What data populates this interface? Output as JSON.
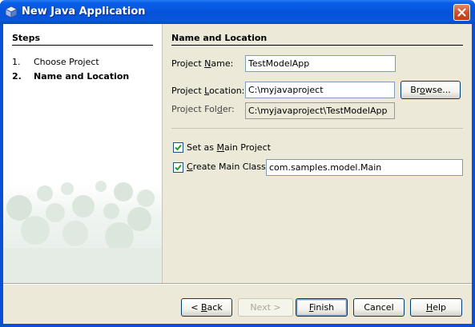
{
  "window": {
    "title": "New Java Application",
    "title_icon": "cube-icon",
    "close_icon": "close-icon"
  },
  "steps": {
    "heading": "Steps",
    "items": [
      {
        "num": "1.",
        "label": "Choose Project",
        "current": false
      },
      {
        "num": "2.",
        "label": "Name and Location",
        "current": true
      }
    ]
  },
  "content": {
    "heading": "Name and Location",
    "project_name": {
      "label_pre": "Project ",
      "label_mnemonic": "N",
      "label_post": "ame:",
      "value": "TestModelApp"
    },
    "project_location": {
      "label_pre": "Project ",
      "label_mnemonic": "L",
      "label_post": "ocation:",
      "value": "C:\\myjavaproject"
    },
    "project_folder": {
      "label_pre": "Project Fol",
      "label_mnemonic": "d",
      "label_post": "er:",
      "value": "C:\\myjavaproject\\TestModelApp"
    },
    "browse": {
      "pre": "Br",
      "mnemonic": "o",
      "post": "wse..."
    },
    "set_main": {
      "checked": true,
      "label_pre": "Set as ",
      "label_mnemonic": "M",
      "label_post": "ain Project"
    },
    "create_main": {
      "checked": true,
      "label_pre": "",
      "label_mnemonic": "C",
      "label_post": "reate Main Class",
      "value": "com.samples.model.Main"
    }
  },
  "buttons": {
    "back": {
      "pre": "< ",
      "mnemonic": "B",
      "post": "ack",
      "enabled": true
    },
    "next": {
      "label": "Next >",
      "enabled": false
    },
    "finish": {
      "pre": "",
      "mnemonic": "F",
      "post": "inish",
      "enabled": true
    },
    "cancel": {
      "label": "Cancel",
      "enabled": true
    },
    "help": {
      "pre": "",
      "mnemonic": "H",
      "post": "elp",
      "enabled": true
    }
  },
  "colors": {
    "titlebar": "#0453d8",
    "dialog_bg": "#ece9d8",
    "close_button": "#d4502a",
    "checkbox_check": "#21a121"
  }
}
